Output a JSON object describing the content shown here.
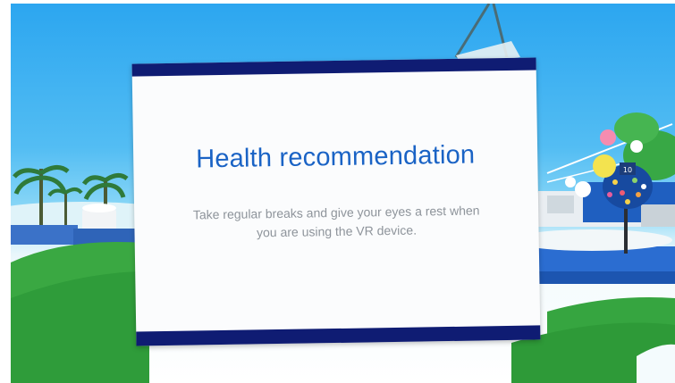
{
  "dialog": {
    "title": "Health recommendation",
    "message": "Take regular breaks and give  your eyes a rest when you are using the VR device."
  },
  "scene": {
    "sign_number": "10",
    "colors": {
      "sky": "#2ca6f0",
      "grass": "#3aa842",
      "dialog_bar": "#0f1c73",
      "title": "#1a63c5"
    }
  }
}
